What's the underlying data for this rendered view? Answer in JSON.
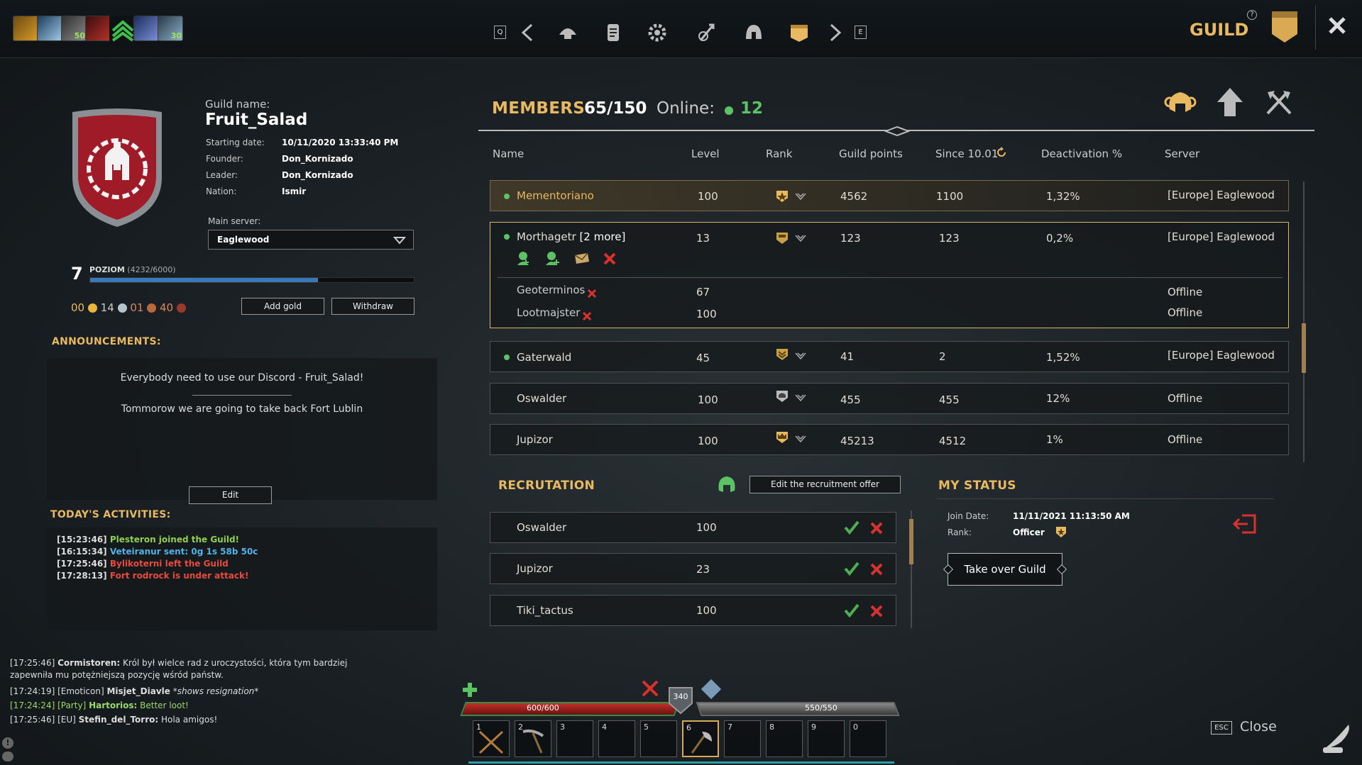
{
  "topbar": {
    "buffs": [
      {
        "icon": "autumn-leaf-icon",
        "badge": ""
      },
      {
        "icon": "spirit-icon",
        "badge": ""
      },
      {
        "icon": "wolf-icon",
        "badge": "50"
      },
      {
        "icon": "serpent-icon",
        "badge": ""
      },
      {
        "icon": "chevrons-up-icon",
        "badge": ""
      },
      {
        "icon": "eagle-icon",
        "badge": ""
      },
      {
        "icon": "feather-icon",
        "badge": "30"
      }
    ],
    "key_q": "Q",
    "key_e": "E",
    "title": "GUILD",
    "help": "?"
  },
  "guild": {
    "name_label": "Guild name:",
    "name": "Fruit_Salad",
    "info": [
      {
        "label": "Starting date:",
        "value": "10/11/2020 13:33:40 PM"
      },
      {
        "label": "Founder:",
        "value": "Don_Kornizado"
      },
      {
        "label": "Leader:",
        "value": "Don_Kornizado"
      },
      {
        "label": "Nation:",
        "value": "Ismir"
      }
    ],
    "main_server_label": "Main server:",
    "main_server": "Eaglewood",
    "level": "7",
    "level_label": "POZIOM",
    "level_progress": "(4232/6000)",
    "level_fraction": 0.705,
    "currency": {
      "gold": "00",
      "silver": "14",
      "copper1": "01",
      "copper2": "40"
    },
    "add_gold": "Add gold",
    "withdraw": "Withdraw"
  },
  "announcements": {
    "title": "ANNOUNCEMENTS:",
    "line1": "Everybody need to use our Discord - Fruit_Salad!",
    "line2": "Tommorow we are going to take back Fort Lublin",
    "edit": "Edit"
  },
  "activities": {
    "title": "TODAY'S ACTIVITIES:",
    "items": [
      {
        "time": "[15:23:46]",
        "text": "Plesteron joined the Guild!",
        "color": "#8fd14f"
      },
      {
        "time": "[16:15:34]",
        "text": "Veteiranur sent: 0g 1s 58b 50c",
        "color": "#4fb3e8"
      },
      {
        "time": "[17:25:46]",
        "text": "Bylikoterni left the Guild",
        "color": "#e84a3c"
      },
      {
        "time": "[17:28:13]",
        "text": "Fort rodrock is under attack!",
        "color": "#e84a3c"
      }
    ]
  },
  "members": {
    "title": "MEMBERS",
    "count": "65/150",
    "online_label": "Online:",
    "online": "12",
    "columns": [
      "Name",
      "Level",
      "Rank",
      "Guild points",
      "Since 10.01",
      "Deactivation %",
      "Server"
    ],
    "rows": [
      {
        "name": "Mementoriano",
        "level": "100",
        "points": "4562",
        "since": "1100",
        "deact": "1,32%",
        "server": "[Europe] Eaglewood"
      },
      {
        "name": "Morthagetr",
        "more": "[2 more]",
        "level": "13",
        "points": "123",
        "since": "123",
        "deact": "0,2%",
        "server": "[Europe] Eaglewood"
      },
      {
        "name": "Gaterwald",
        "level": "45",
        "points": "41",
        "since": "2",
        "deact": "1,52%",
        "server": "[Europe] Eaglewood"
      },
      {
        "name": "Oswalder",
        "level": "100",
        "points": "455",
        "since": "455",
        "deact": "12%",
        "server": "Offline"
      },
      {
        "name": "Jupizor",
        "level": "100",
        "points": "45213",
        "since": "4512",
        "deact": "1%",
        "server": "Offline"
      }
    ],
    "alts": [
      {
        "name": "Geoterminos",
        "level": "67",
        "server": "Offline"
      },
      {
        "name": "Lootmajster",
        "level": "100",
        "server": "Offline"
      }
    ]
  },
  "recruitment": {
    "title": "RECRUTATION",
    "edit_offer": "Edit the recruitment offer",
    "rows": [
      {
        "name": "Oswalder",
        "level": "100"
      },
      {
        "name": "Jupizor",
        "level": "23"
      },
      {
        "name": "Tiki_tactus",
        "level": "100"
      }
    ]
  },
  "status": {
    "title": "MY STATUS",
    "join_label": "Join Date:",
    "join_date": "11/11/2021 11:13:50 AM",
    "rank_label": "Rank:",
    "rank": "Officer",
    "take_over": "Take over Guild"
  },
  "chat": [
    {
      "prefix": "[17:25:46]",
      "name": "Cormistoren:",
      "text": "Król był wielce rad z uroczystości, która tym bardziej",
      "cont": "zapewniła mu potężniejszą pozycję wśród państw.",
      "color": "#dddddd"
    },
    {
      "prefix": "[17:24:19] [Emoticon]",
      "name": "Misjet_Diavle",
      "text": "*shows resignation*",
      "color": "#dddddd"
    },
    {
      "prefix": "[17:24:24] [Party]",
      "name": "Hartorios:",
      "text": "Better loot!",
      "color": "#9ad86a"
    },
    {
      "prefix": "[17:25:46] [EU]",
      "name": "Stefin_del_Torro:",
      "text": "Hola amigos!",
      "color": "#dddddd"
    }
  ],
  "hud": {
    "health": "600/600",
    "health_fraction": 1.0,
    "armor": "340",
    "stamina": "550/550",
    "stamina_fraction": 1.0,
    "slots": [
      "1",
      "2",
      "3",
      "4",
      "5",
      "6",
      "7",
      "8",
      "9",
      "0"
    ]
  },
  "footer": {
    "esc": "ESC",
    "close": "Close"
  },
  "colors": {
    "accent": "#e8b960",
    "online": "#5cc364",
    "accept": "#4caf50",
    "reject": "#d9322e"
  }
}
